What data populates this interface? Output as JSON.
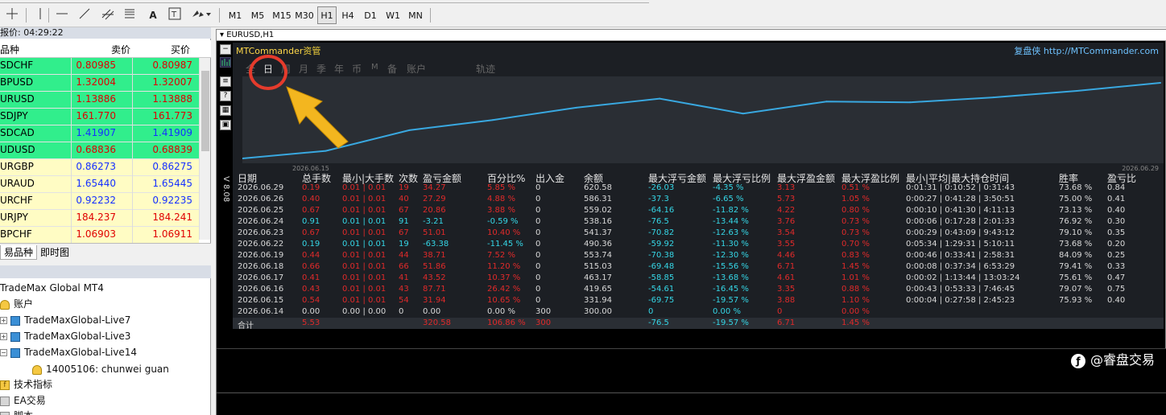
{
  "toolbar": {
    "timeframes": [
      "M1",
      "M5",
      "M15",
      "M30",
      "H1",
      "H4",
      "D1",
      "W1",
      "MN"
    ],
    "active_timeframe": "H1",
    "tools": [
      "crosshair",
      "vertical-line",
      "horizontal-line",
      "trendline",
      "fibonacci",
      "text-A",
      "text-label",
      "arrows"
    ]
  },
  "market_watch": {
    "title": "报价: 04:29:22",
    "col_symbol": "品种",
    "col_bid": "卖价",
    "col_ask": "买价",
    "rows": [
      {
        "symbol": "SDCHF",
        "bid": "0.80985",
        "ask": "0.80987",
        "bg": "#31ee8c",
        "color": "#e00000"
      },
      {
        "symbol": "BPUSD",
        "bid": "1.32004",
        "ask": "1.32007",
        "bg": "#31ee8c",
        "color": "#e00000"
      },
      {
        "symbol": "URUSD",
        "bid": "1.13886",
        "ask": "1.13888",
        "bg": "#31ee8c",
        "color": "#e00000"
      },
      {
        "symbol": "SDJPY",
        "bid": "161.770",
        "ask": "161.773",
        "bg": "#31ee8c",
        "color": "#e00000"
      },
      {
        "symbol": "SDCAD",
        "bid": "1.41907",
        "ask": "1.41909",
        "bg": "#31ee8c",
        "color": "#1530ff"
      },
      {
        "symbol": "UDUSD",
        "bid": "0.68836",
        "ask": "0.68839",
        "bg": "#31ee8c",
        "color": "#e00000"
      },
      {
        "symbol": "URGBP",
        "bid": "0.86273",
        "ask": "0.86275",
        "bg": "#fffcc4",
        "color": "#1530ff"
      },
      {
        "symbol": "URAUD",
        "bid": "1.65440",
        "ask": "1.65445",
        "bg": "#fffcc4",
        "color": "#1530ff"
      },
      {
        "symbol": "URCHF",
        "bid": "0.92232",
        "ask": "0.92235",
        "bg": "#fffcc4",
        "color": "#1530ff"
      },
      {
        "symbol": "URJPY",
        "bid": "184.237",
        "ask": "184.241",
        "bg": "#fffcc4",
        "color": "#e00000"
      },
      {
        "symbol": "BPCHF",
        "bid": "1.06903",
        "ask": "1.06911",
        "bg": "#fffcc4",
        "color": "#e00000"
      }
    ],
    "tabs": [
      "易品种",
      "即时图"
    ]
  },
  "navigator": {
    "root": "TradeMax Global MT4",
    "accounts_label": "账户",
    "accounts": [
      "TradeMaxGlobal-Live7",
      "TradeMaxGlobal-Live3",
      "TradeMaxGlobal-Live14"
    ],
    "sub_account": "14005106: chunwei guan",
    "indicators": "技术指标",
    "ea": "EA交易",
    "scripts": "脚本"
  },
  "chart": {
    "title": "EURUSD,H1",
    "vertical_label": "V 8.08"
  },
  "panel": {
    "title_mc": "MTCommander",
    "title_suffix": "资管",
    "brand": "复盘侠 http://MTCommander.com",
    "periods": [
      "全",
      "日",
      "周",
      "月",
      "季",
      "年",
      "币",
      "M",
      "备",
      "账户",
      "轨迹"
    ],
    "date_start": "2026.06.15",
    "date_end": "2026.06.29"
  },
  "chart_data": {
    "type": "line",
    "x": [
      "2026.06.14",
      "2026.06.15",
      "2026.06.16",
      "2026.06.17",
      "2026.06.18",
      "2026.06.19",
      "2026.06.22",
      "2026.06.23",
      "2026.06.24",
      "2026.06.25",
      "2026.06.26",
      "2026.06.29"
    ],
    "series": [
      {
        "values": [
          300.0,
          331.94,
          419.65,
          463.17,
          515.03,
          553.74,
          490.36,
          541.37,
          538.16,
          559.02,
          586.31,
          620.58
        ]
      }
    ],
    "color": "#39a8e0"
  },
  "table": {
    "headers": [
      "日期",
      "总手数",
      "最小|大手数",
      "次数",
      "盈亏金额",
      "百分比%",
      "出入金",
      "余额",
      "最大浮亏金额",
      "最大浮亏比例",
      "最大浮盈金额",
      "最大浮盈比例",
      "最小|平均|最大持仓时间",
      "胜率",
      "盈亏比"
    ],
    "rows": [
      [
        "2026.06.29",
        "0.19",
        "0.01 | 0.01",
        "19",
        "34.27",
        "5.85 %",
        "0",
        "620.58",
        "-26.03",
        "-4.35 %",
        "3.13",
        "0.51 %",
        "0:01:31 | 0:10:52 | 0:31:43",
        "73.68 %",
        "0.84"
      ],
      [
        "2026.06.26",
        "0.40",
        "0.01 | 0.01",
        "40",
        "27.29",
        "4.88 %",
        "0",
        "586.31",
        "-37.3",
        "-6.65 %",
        "5.73",
        "1.05 %",
        "0:00:27 | 0:41:28 | 3:50:51",
        "75.00 %",
        "0.41"
      ],
      [
        "2026.06.25",
        "0.67",
        "0.01 | 0.01",
        "67",
        "20.86",
        "3.88 %",
        "0",
        "559.02",
        "-64.16",
        "-11.82 %",
        "4.22",
        "0.80 %",
        "0:00:10 | 0:41:30 | 4:11:13",
        "73.13 %",
        "0.40"
      ],
      [
        "2026.06.24",
        "0.91",
        "0.01 | 0.01",
        "91",
        "-3.21",
        "-0.59 %",
        "0",
        "538.16",
        "-76.5",
        "-13.44 %",
        "3.76",
        "0.73 %",
        "0:00:06 | 0:17:28 | 2:01:33",
        "76.92 %",
        "0.30"
      ],
      [
        "2026.06.23",
        "0.67",
        "0.01 | 0.01",
        "67",
        "51.01",
        "10.40 %",
        "0",
        "541.37",
        "-70.82",
        "-12.63 %",
        "3.54",
        "0.73 %",
        "0:00:29 | 0:43:09 | 9:43:12",
        "79.10 %",
        "0.35"
      ],
      [
        "2026.06.22",
        "0.19",
        "0.01 | 0.01",
        "19",
        "-63.38",
        "-11.45 %",
        "0",
        "490.36",
        "-59.92",
        "-11.30 %",
        "3.55",
        "0.70 %",
        "0:05:34 | 1:29:31 | 5:10:11",
        "73.68 %",
        "0.20"
      ],
      [
        "2026.06.19",
        "0.44",
        "0.01 | 0.01",
        "44",
        "38.71",
        "7.52 %",
        "0",
        "553.74",
        "-70.38",
        "-12.30 %",
        "4.46",
        "0.83 %",
        "0:00:46 | 0:33:41 | 2:58:31",
        "84.09 %",
        "0.25"
      ],
      [
        "2026.06.18",
        "0.66",
        "0.01 | 0.01",
        "66",
        "51.86",
        "11.20 %",
        "0",
        "515.03",
        "-69.48",
        "-15.56 %",
        "6.71",
        "1.45 %",
        "0:00:08 | 0:37:34 | 6:53:29",
        "79.41 %",
        "0.33"
      ],
      [
        "2026.06.17",
        "0.41",
        "0.01 | 0.01",
        "41",
        "43.52",
        "10.37 %",
        "0",
        "463.17",
        "-58.85",
        "-13.68 %",
        "4.61",
        "1.01 %",
        "0:00:02 | 1:13:44 | 13:03:24",
        "75.61 %",
        "0.47"
      ],
      [
        "2026.06.16",
        "0.43",
        "0.01 | 0.01",
        "43",
        "87.71",
        "26.42 %",
        "0",
        "419.65",
        "-54.61",
        "-16.45 %",
        "3.35",
        "0.88 %",
        "0:00:43 | 0:53:33 | 7:46:45",
        "79.07 %",
        "0.75"
      ],
      [
        "2026.06.15",
        "0.54",
        "0.01 | 0.01",
        "54",
        "31.94",
        "10.65 %",
        "0",
        "331.94",
        "-69.75",
        "-19.57 %",
        "3.88",
        "1.10 %",
        "0:00:04 | 0:27:58 | 2:45:23",
        "75.93 %",
        "0.40"
      ],
      [
        "2026.06.14",
        "0.00",
        "0.00 | 0.00",
        "0",
        "0.00",
        "0.00 %",
        "300",
        "300.00",
        "0",
        "0.00 %",
        "0",
        "0.00 %",
        "",
        "",
        ""
      ]
    ],
    "total": [
      "合计",
      "5.53",
      "",
      "",
      "320.58",
      "106.86 %",
      "300",
      "",
      "-76.5",
      "-19.57 %",
      "6.71",
      "1.45 %",
      "",
      "",
      ""
    ]
  },
  "watermark": "@睿盘交易"
}
